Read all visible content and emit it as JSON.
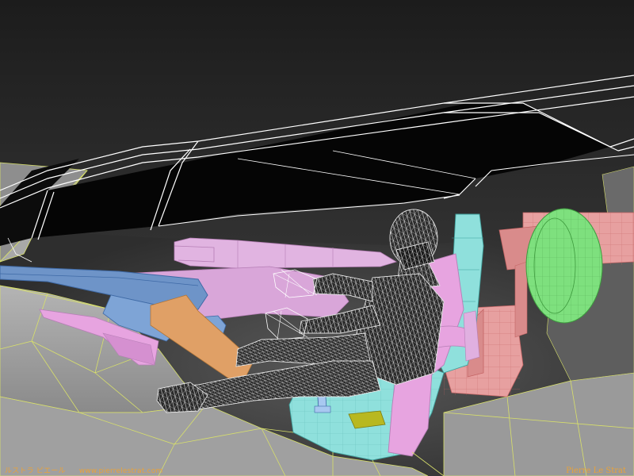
{
  "render": {
    "colors": {
      "background_top": "#202020",
      "background_mid": "#3a3a3a",
      "floor": "#9c9c9c",
      "floor_wire": "#d8e06a",
      "window_black": "#050505",
      "frame_white": "#ffffff",
      "dash_blue": "#6e94c8",
      "wheel_green": "#7ee07e",
      "pedal_pink": "#e7a0a0",
      "seat_cyan": "#8fe0dc",
      "seat_pink": "#e7a4e0",
      "panel_lilac": "#d9a6d9",
      "column_orange": "#e0a066",
      "cushion_yellow": "#b8b820",
      "mesh_wire": "#e6e6e6",
      "footer_text": "#e8a23a"
    }
  },
  "footer": {
    "kana": "ルストラ ピエール",
    "url": "www.pierrelestrat.com",
    "author": "Pierre Le Strat"
  }
}
